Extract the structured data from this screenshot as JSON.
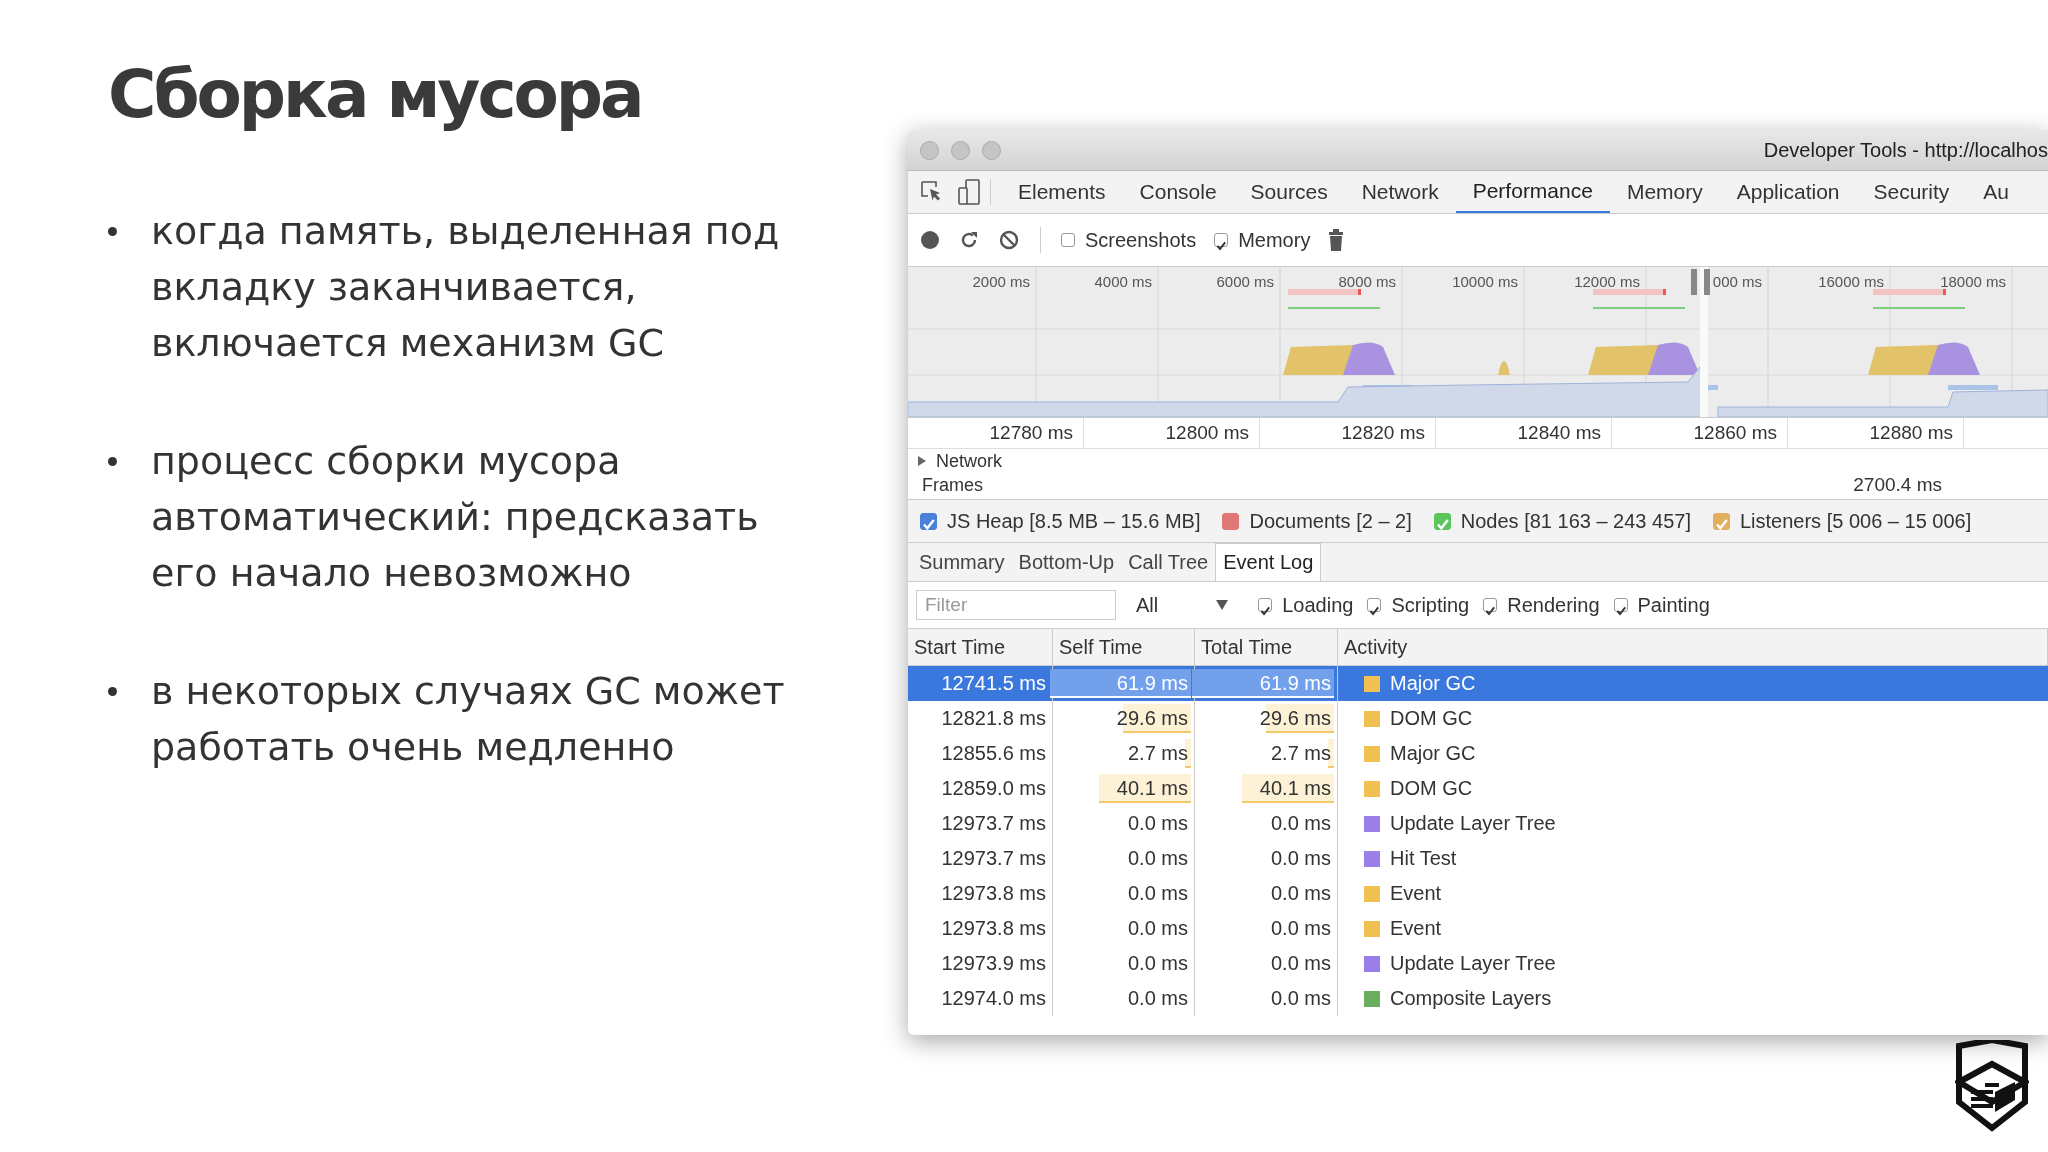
{
  "slide": {
    "title": "Сборка мусора",
    "bullets": [
      "когда память, выделенная под вкладку заканчивается, включается механизм GC",
      "процесс сборки мусора автоматический: предсказать его начало невозможно",
      "в некоторых случаях GC может работать очень медленно"
    ]
  },
  "devtools": {
    "window_title": "Developer Tools - http://localhos",
    "tabs": [
      {
        "label": "Elements",
        "selected": false
      },
      {
        "label": "Console",
        "selected": false
      },
      {
        "label": "Sources",
        "selected": false
      },
      {
        "label": "Network",
        "selected": false
      },
      {
        "label": "Performance",
        "selected": true
      },
      {
        "label": "Memory",
        "selected": false
      },
      {
        "label": "Application",
        "selected": false
      },
      {
        "label": "Security",
        "selected": false
      },
      {
        "label": "Au",
        "selected": false
      }
    ],
    "toolbar_checkboxes": [
      {
        "label": "Screenshots",
        "checked": false
      },
      {
        "label": "Memory",
        "checked": true
      }
    ],
    "overview_ticks": [
      "2000 ms",
      "4000 ms",
      "6000 ms",
      "8000 ms",
      "10000 ms",
      "12000 ms",
      "000 ms",
      "16000 ms",
      "18000 ms"
    ],
    "ruler_ticks": [
      "12780 ms",
      "12800 ms",
      "12820 ms",
      "12840 ms",
      "12860 ms",
      "12880 ms"
    ],
    "tracks": [
      {
        "label": "Network",
        "expanded": false
      },
      {
        "label": "Frames",
        "reading": "2700.4 ms"
      }
    ],
    "memory_legend": [
      {
        "label": "JS Heap [8.5 MB – 15.6 MB]",
        "checked": true,
        "color": "#4a80d9"
      },
      {
        "label": "Documents [2 – 2]",
        "checked": false,
        "color": "#e07878"
      },
      {
        "label": "Nodes [81 163 – 243 457]",
        "checked": true,
        "color": "#5cc65c"
      },
      {
        "label": "Listeners [5 006 – 15 006]",
        "checked": true,
        "color": "#e0b060"
      }
    ],
    "subtabs": [
      {
        "label": "Summary",
        "selected": false
      },
      {
        "label": "Bottom-Up",
        "selected": false
      },
      {
        "label": "Call Tree",
        "selected": false
      },
      {
        "label": "Event Log",
        "selected": true
      }
    ],
    "filter": {
      "placeholder": "Filter",
      "select_value": "All",
      "categories": [
        {
          "label": "Loading",
          "checked": true
        },
        {
          "label": "Scripting",
          "checked": true
        },
        {
          "label": "Rendering",
          "checked": true
        },
        {
          "label": "Painting",
          "checked": true
        }
      ]
    },
    "table": {
      "columns": [
        "Start Time",
        "Self Time",
        "Total Time",
        "Activity"
      ],
      "rows": [
        {
          "start": "12741.5 ms",
          "self": "61.9 ms",
          "total": "61.9 ms",
          "activity": "Major GC",
          "color": "#f0c050",
          "selected": true,
          "self_bar": {
            "level": 1
          },
          "total_bar": {
            "level": 1
          }
        },
        {
          "start": "12821.8 ms",
          "self": "29.6 ms",
          "total": "29.6 ms",
          "activity": "DOM GC",
          "color": "#f0c050",
          "selected": false,
          "self_bar": {
            "level": 0.48
          },
          "total_bar": {
            "level": 0.48
          }
        },
        {
          "start": "12855.6 ms",
          "self": "2.7 ms",
          "total": "2.7 ms",
          "activity": "Major GC",
          "color": "#f0c050",
          "selected": false,
          "self_bar": {
            "level": 0.04
          },
          "total_bar": {
            "level": 0.04
          }
        },
        {
          "start": "12859.0 ms",
          "self": "40.1 ms",
          "total": "40.1 ms",
          "activity": "DOM GC",
          "color": "#f0c050",
          "selected": false,
          "self_bar": {
            "level": 0.65
          },
          "total_bar": {
            "level": 0.65
          }
        },
        {
          "start": "12973.7 ms",
          "self": "0.0 ms",
          "total": "0.0 ms",
          "activity": "Update Layer Tree",
          "color": "#9b7fe6",
          "selected": false
        },
        {
          "start": "12973.7 ms",
          "self": "0.0 ms",
          "total": "0.0 ms",
          "activity": "Hit Test",
          "color": "#9b7fe6",
          "selected": false
        },
        {
          "start": "12973.8 ms",
          "self": "0.0 ms",
          "total": "0.0 ms",
          "activity": "Event",
          "color": "#f0c050",
          "selected": false
        },
        {
          "start": "12973.8 ms",
          "self": "0.0 ms",
          "total": "0.0 ms",
          "activity": "Event",
          "color": "#f0c050",
          "selected": false
        },
        {
          "start": "12973.9 ms",
          "self": "0.0 ms",
          "total": "0.0 ms",
          "activity": "Update Layer Tree",
          "color": "#9b7fe6",
          "selected": false
        },
        {
          "start": "12974.0 ms",
          "self": "0.0 ms",
          "total": "0.0 ms",
          "activity": "Composite Layers",
          "color": "#6aad5f",
          "selected": false
        }
      ]
    }
  }
}
